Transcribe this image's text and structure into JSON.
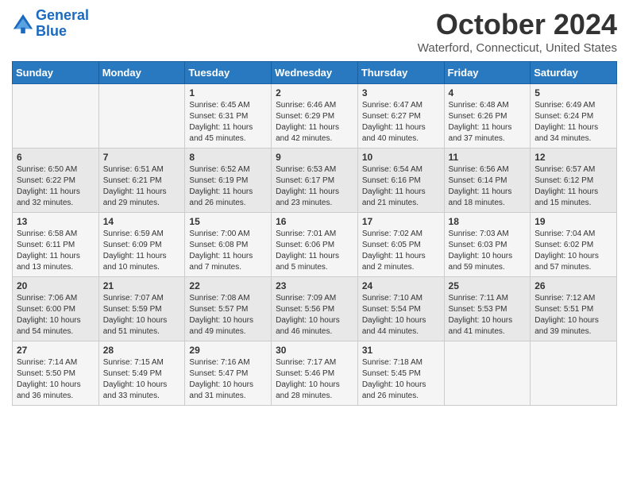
{
  "logo": {
    "line1": "General",
    "line2": "Blue"
  },
  "title": "October 2024",
  "location": "Waterford, Connecticut, United States",
  "days_of_week": [
    "Sunday",
    "Monday",
    "Tuesday",
    "Wednesday",
    "Thursday",
    "Friday",
    "Saturday"
  ],
  "weeks": [
    [
      {
        "day": "",
        "sunrise": "",
        "sunset": "",
        "daylight": ""
      },
      {
        "day": "",
        "sunrise": "",
        "sunset": "",
        "daylight": ""
      },
      {
        "day": "1",
        "sunrise": "Sunrise: 6:45 AM",
        "sunset": "Sunset: 6:31 PM",
        "daylight": "Daylight: 11 hours and 45 minutes."
      },
      {
        "day": "2",
        "sunrise": "Sunrise: 6:46 AM",
        "sunset": "Sunset: 6:29 PM",
        "daylight": "Daylight: 11 hours and 42 minutes."
      },
      {
        "day": "3",
        "sunrise": "Sunrise: 6:47 AM",
        "sunset": "Sunset: 6:27 PM",
        "daylight": "Daylight: 11 hours and 40 minutes."
      },
      {
        "day": "4",
        "sunrise": "Sunrise: 6:48 AM",
        "sunset": "Sunset: 6:26 PM",
        "daylight": "Daylight: 11 hours and 37 minutes."
      },
      {
        "day": "5",
        "sunrise": "Sunrise: 6:49 AM",
        "sunset": "Sunset: 6:24 PM",
        "daylight": "Daylight: 11 hours and 34 minutes."
      }
    ],
    [
      {
        "day": "6",
        "sunrise": "Sunrise: 6:50 AM",
        "sunset": "Sunset: 6:22 PM",
        "daylight": "Daylight: 11 hours and 32 minutes."
      },
      {
        "day": "7",
        "sunrise": "Sunrise: 6:51 AM",
        "sunset": "Sunset: 6:21 PM",
        "daylight": "Daylight: 11 hours and 29 minutes."
      },
      {
        "day": "8",
        "sunrise": "Sunrise: 6:52 AM",
        "sunset": "Sunset: 6:19 PM",
        "daylight": "Daylight: 11 hours and 26 minutes."
      },
      {
        "day": "9",
        "sunrise": "Sunrise: 6:53 AM",
        "sunset": "Sunset: 6:17 PM",
        "daylight": "Daylight: 11 hours and 23 minutes."
      },
      {
        "day": "10",
        "sunrise": "Sunrise: 6:54 AM",
        "sunset": "Sunset: 6:16 PM",
        "daylight": "Daylight: 11 hours and 21 minutes."
      },
      {
        "day": "11",
        "sunrise": "Sunrise: 6:56 AM",
        "sunset": "Sunset: 6:14 PM",
        "daylight": "Daylight: 11 hours and 18 minutes."
      },
      {
        "day": "12",
        "sunrise": "Sunrise: 6:57 AM",
        "sunset": "Sunset: 6:12 PM",
        "daylight": "Daylight: 11 hours and 15 minutes."
      }
    ],
    [
      {
        "day": "13",
        "sunrise": "Sunrise: 6:58 AM",
        "sunset": "Sunset: 6:11 PM",
        "daylight": "Daylight: 11 hours and 13 minutes."
      },
      {
        "day": "14",
        "sunrise": "Sunrise: 6:59 AM",
        "sunset": "Sunset: 6:09 PM",
        "daylight": "Daylight: 11 hours and 10 minutes."
      },
      {
        "day": "15",
        "sunrise": "Sunrise: 7:00 AM",
        "sunset": "Sunset: 6:08 PM",
        "daylight": "Daylight: 11 hours and 7 minutes."
      },
      {
        "day": "16",
        "sunrise": "Sunrise: 7:01 AM",
        "sunset": "Sunset: 6:06 PM",
        "daylight": "Daylight: 11 hours and 5 minutes."
      },
      {
        "day": "17",
        "sunrise": "Sunrise: 7:02 AM",
        "sunset": "Sunset: 6:05 PM",
        "daylight": "Daylight: 11 hours and 2 minutes."
      },
      {
        "day": "18",
        "sunrise": "Sunrise: 7:03 AM",
        "sunset": "Sunset: 6:03 PM",
        "daylight": "Daylight: 10 hours and 59 minutes."
      },
      {
        "day": "19",
        "sunrise": "Sunrise: 7:04 AM",
        "sunset": "Sunset: 6:02 PM",
        "daylight": "Daylight: 10 hours and 57 minutes."
      }
    ],
    [
      {
        "day": "20",
        "sunrise": "Sunrise: 7:06 AM",
        "sunset": "Sunset: 6:00 PM",
        "daylight": "Daylight: 10 hours and 54 minutes."
      },
      {
        "day": "21",
        "sunrise": "Sunrise: 7:07 AM",
        "sunset": "Sunset: 5:59 PM",
        "daylight": "Daylight: 10 hours and 51 minutes."
      },
      {
        "day": "22",
        "sunrise": "Sunrise: 7:08 AM",
        "sunset": "Sunset: 5:57 PM",
        "daylight": "Daylight: 10 hours and 49 minutes."
      },
      {
        "day": "23",
        "sunrise": "Sunrise: 7:09 AM",
        "sunset": "Sunset: 5:56 PM",
        "daylight": "Daylight: 10 hours and 46 minutes."
      },
      {
        "day": "24",
        "sunrise": "Sunrise: 7:10 AM",
        "sunset": "Sunset: 5:54 PM",
        "daylight": "Daylight: 10 hours and 44 minutes."
      },
      {
        "day": "25",
        "sunrise": "Sunrise: 7:11 AM",
        "sunset": "Sunset: 5:53 PM",
        "daylight": "Daylight: 10 hours and 41 minutes."
      },
      {
        "day": "26",
        "sunrise": "Sunrise: 7:12 AM",
        "sunset": "Sunset: 5:51 PM",
        "daylight": "Daylight: 10 hours and 39 minutes."
      }
    ],
    [
      {
        "day": "27",
        "sunrise": "Sunrise: 7:14 AM",
        "sunset": "Sunset: 5:50 PM",
        "daylight": "Daylight: 10 hours and 36 minutes."
      },
      {
        "day": "28",
        "sunrise": "Sunrise: 7:15 AM",
        "sunset": "Sunset: 5:49 PM",
        "daylight": "Daylight: 10 hours and 33 minutes."
      },
      {
        "day": "29",
        "sunrise": "Sunrise: 7:16 AM",
        "sunset": "Sunset: 5:47 PM",
        "daylight": "Daylight: 10 hours and 31 minutes."
      },
      {
        "day": "30",
        "sunrise": "Sunrise: 7:17 AM",
        "sunset": "Sunset: 5:46 PM",
        "daylight": "Daylight: 10 hours and 28 minutes."
      },
      {
        "day": "31",
        "sunrise": "Sunrise: 7:18 AM",
        "sunset": "Sunset: 5:45 PM",
        "daylight": "Daylight: 10 hours and 26 minutes."
      },
      {
        "day": "",
        "sunrise": "",
        "sunset": "",
        "daylight": ""
      },
      {
        "day": "",
        "sunrise": "",
        "sunset": "",
        "daylight": ""
      }
    ]
  ]
}
